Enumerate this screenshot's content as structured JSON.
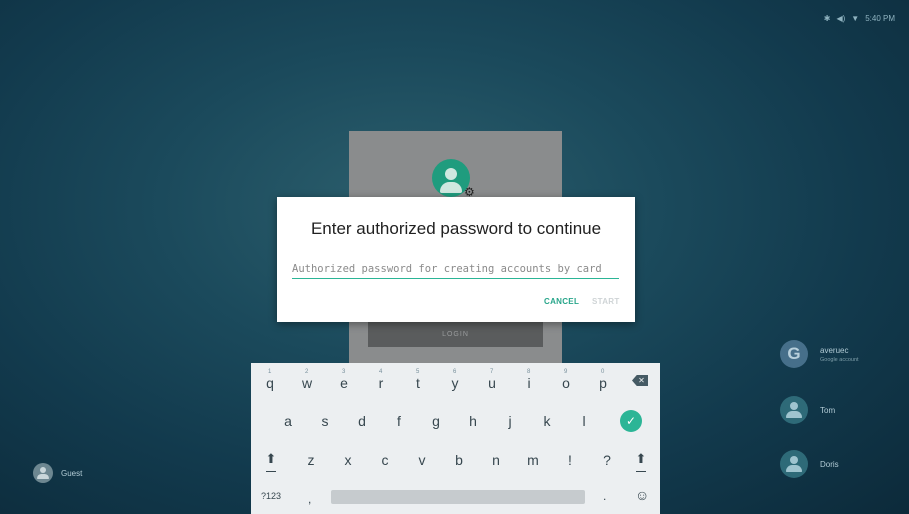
{
  "status_bar": {
    "icons": [
      "bluetooth-icon",
      "volume-icon",
      "wifi-icon"
    ],
    "time": "5:40 PM"
  },
  "background_login": {
    "login_label": "LOGIN"
  },
  "dialog": {
    "title": "Enter authorized password to continue",
    "password_placeholder": "Authorized password for creating accounts by card",
    "password_value": "",
    "cancel_label": "CANCEL",
    "start_label": "START",
    "accent_color": "#2bb596"
  },
  "keyboard": {
    "row1": [
      {
        "key": "q",
        "hint": "1"
      },
      {
        "key": "w",
        "hint": "2"
      },
      {
        "key": "e",
        "hint": "3"
      },
      {
        "key": "r",
        "hint": "4"
      },
      {
        "key": "t",
        "hint": "5"
      },
      {
        "key": "y",
        "hint": "6"
      },
      {
        "key": "u",
        "hint": "7"
      },
      {
        "key": "i",
        "hint": "8"
      },
      {
        "key": "o",
        "hint": "9"
      },
      {
        "key": "p",
        "hint": "0"
      }
    ],
    "row2": [
      "a",
      "s",
      "d",
      "f",
      "g",
      "h",
      "j",
      "k",
      "l"
    ],
    "row3": [
      "z",
      "x",
      "c",
      "v",
      "b",
      "n",
      "m",
      "!",
      "?"
    ],
    "symbols_label": "?123",
    "comma_label": ",",
    "period_label": ".",
    "emoji_glyph": "☺",
    "enter_glyph": "✓"
  },
  "users": {
    "guest": "Guest",
    "accounts": [
      {
        "name": "averuec",
        "subtitle": "Google account",
        "avatar": "G"
      },
      {
        "name": "Tom"
      },
      {
        "name": "Doris"
      }
    ]
  }
}
